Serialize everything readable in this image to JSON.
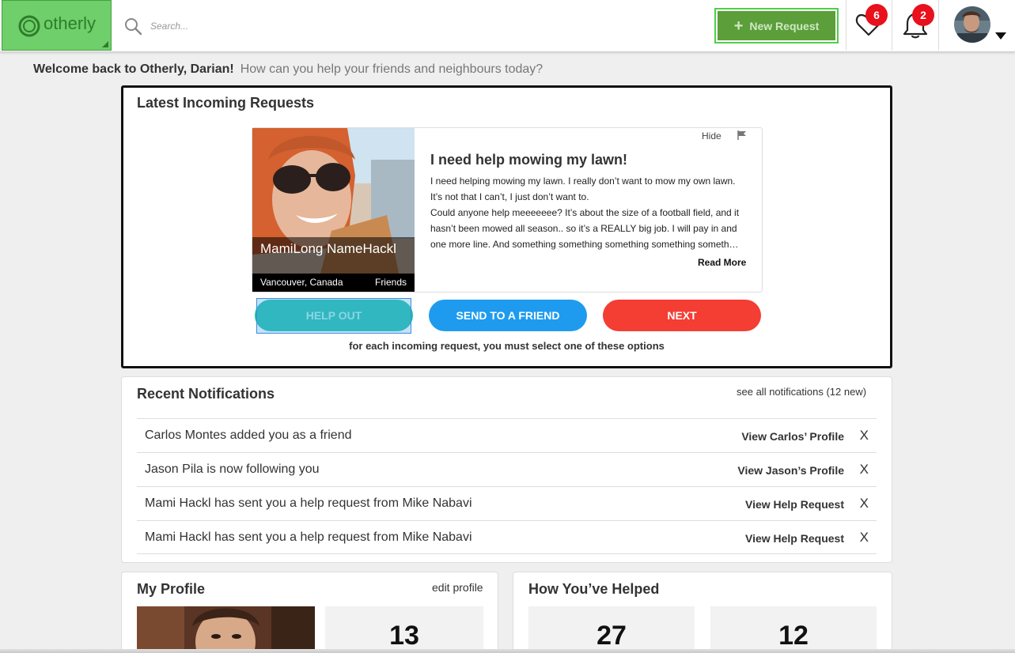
{
  "brand": {
    "name": "otherly",
    "color": "#6fcf6a"
  },
  "search": {
    "placeholder": "Search..."
  },
  "header": {
    "new_request_label": "New Request",
    "new_request_icon": "plus-icon",
    "favorites_count": "6",
    "notifications_count": "2",
    "favorites_icon": "heart-icon",
    "notifications_icon": "bell-icon"
  },
  "welcome": {
    "greeting": "Welcome back to Otherly, Darian!",
    "subtitle": "How can you help your friends and neighbours today?"
  },
  "requests": {
    "title": "Latest Incoming Requests",
    "hide_label": "Hide",
    "card": {
      "requester_name": "MamiLong NameHackl",
      "location": "Vancouver, Canada",
      "relation": "Friends",
      "title": "I need help mowing my lawn!",
      "body": "I need helping mowing my lawn. I really don’t want to mow my own lawn. It’s not that I can’t, I just don’t want to.",
      "body2": "Could anyone help meeeeeee? It’s about the size of a football field, and it hasn’t been mowed all season.. so it’s a REALLY big job. I will pay in and one more line. And something something something something someth…",
      "read_more": "Read More"
    },
    "actions": {
      "help": "HELP OUT",
      "send": "SEND TO A FRIEND",
      "next": "NEXT"
    },
    "action_colors": {
      "help": "#1dbfa5",
      "send": "#1e9bef",
      "next": "#f43d33"
    },
    "hint": "for each incoming request, you must select one of these options"
  },
  "notifications": {
    "title": "Recent Notifications",
    "see_all": "see all notifications (12 new)",
    "items": [
      {
        "text": "Carlos Montes added you as a friend",
        "link": "View Carlos’ Profile",
        "close": "X"
      },
      {
        "text": "Jason Pila is now following you",
        "link": "View Jason’s Profile",
        "close": "X"
      },
      {
        "text": "Mami Hackl has sent you a help request from Mike Nabavi",
        "link": "View Help Request",
        "close": "X"
      },
      {
        "text": "Mami Hackl has sent you a help request from Mike Nabavi",
        "link": "View Help Request",
        "close": "X"
      }
    ]
  },
  "profile": {
    "title": "My Profile",
    "edit_label": "edit profile",
    "stat": "13"
  },
  "helped": {
    "title": "How You’ve Helped",
    "stats": [
      "27",
      "12"
    ]
  }
}
